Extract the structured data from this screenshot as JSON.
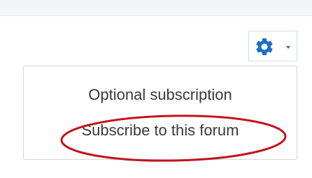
{
  "forum_settings": {
    "gear_icon": "gear-icon",
    "caret_icon": "caret-down-icon",
    "accent_color": "#1a6fc5"
  },
  "menu": {
    "heading": "Optional subscription",
    "subscribe_label": "Subscribe to this forum"
  },
  "annotation": {
    "highlight_color": "#c0141c"
  }
}
